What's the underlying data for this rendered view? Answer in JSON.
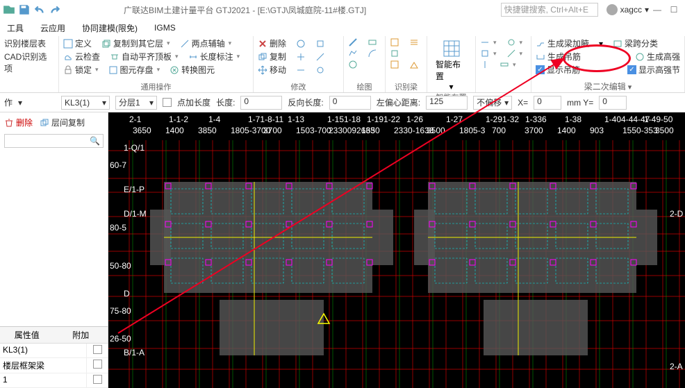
{
  "title": "广联达BIM土建计量平台 GTJ2021 - [E:\\GTJ\\凤城庭院-11#楼.GTJ]",
  "search_placeholder": "快捷键搜索, Ctrl+Alt+E",
  "username": "xagcc",
  "menu": [
    "工具",
    "云应用",
    "协同建模(限免)",
    "IGMS"
  ],
  "ribbon": {
    "p1_r1": "识别楼层表",
    "p1_r2": "CAD识别选项",
    "p2": {
      "r1": [
        "定义",
        "复制到其它层",
        "两点辅轴"
      ],
      "r2": [
        "云检查",
        "自动平齐顶板",
        "长度标注"
      ],
      "r3": [
        "锁定",
        "图元存盘",
        "转换图元"
      ],
      "label": "通用操作"
    },
    "p3": {
      "r1": "删除",
      "r2": "复制",
      "r3": "移动",
      "label": "修改"
    },
    "p4": {
      "label": "绘图"
    },
    "p5": {
      "label": "识别梁"
    },
    "p6": {
      "big": "智能布置",
      "label": "智能布置"
    },
    "p8": {
      "r1a": "生成梁加腋",
      "r1b": "梁跨分类",
      "r2a": "生成吊筋",
      "r3a": "显示吊筋",
      "r3b": "显示高强节",
      "label": "梁二次编辑"
    }
  },
  "optbar": {
    "left_label": "作",
    "sel1": "KL3(1)",
    "sel2": "分层1",
    "dotlen": "点加长度",
    "len_lbl": "长度:",
    "len_val": "0",
    "revlen_lbl": "反向长度:",
    "revlen_val": "0",
    "offctr_lbl": "左偏心距离:",
    "offctr_val": "125",
    "nooff": "不偏移",
    "x_lbl": "X=",
    "x_val": "0",
    "mm_lbl": "mm Y=",
    "y_val": "0"
  },
  "left": {
    "del": "删除",
    "copy": "层间复制",
    "search_icon": "🔍",
    "props_hdr1": "属性值",
    "props_hdr2": "附加",
    "props": [
      "KL3(1)",
      "楼层框架梁",
      "1"
    ]
  },
  "canvas": {
    "top_labels_a": [
      "2-1",
      "1-1-2",
      "1-4",
      "1-71-8-11",
      "1-13",
      "1-151-18",
      "1-191-22",
      "1-26",
      "1-27",
      "1-291-32",
      "1-336",
      "1-38",
      "1-404-44-47",
      "1-49-50"
    ],
    "top_labels_b": [
      "3650",
      "1400",
      "3850",
      "1805-3700",
      "3700",
      "1503-700",
      "2330092633",
      "1650",
      "2330-1638",
      "3500",
      "1805-3",
      "700",
      "3700",
      "1400",
      "903",
      "1550-353",
      "3500"
    ],
    "left_labels": [
      "1-Q/1",
      "E/1-P",
      "D/1-M",
      "D",
      "B/1-A"
    ],
    "right_labels": [
      "2-D",
      "2-A"
    ],
    "left_nums": [
      "60-7",
      "80-5",
      "50-80",
      "75-80",
      "26-50"
    ]
  }
}
